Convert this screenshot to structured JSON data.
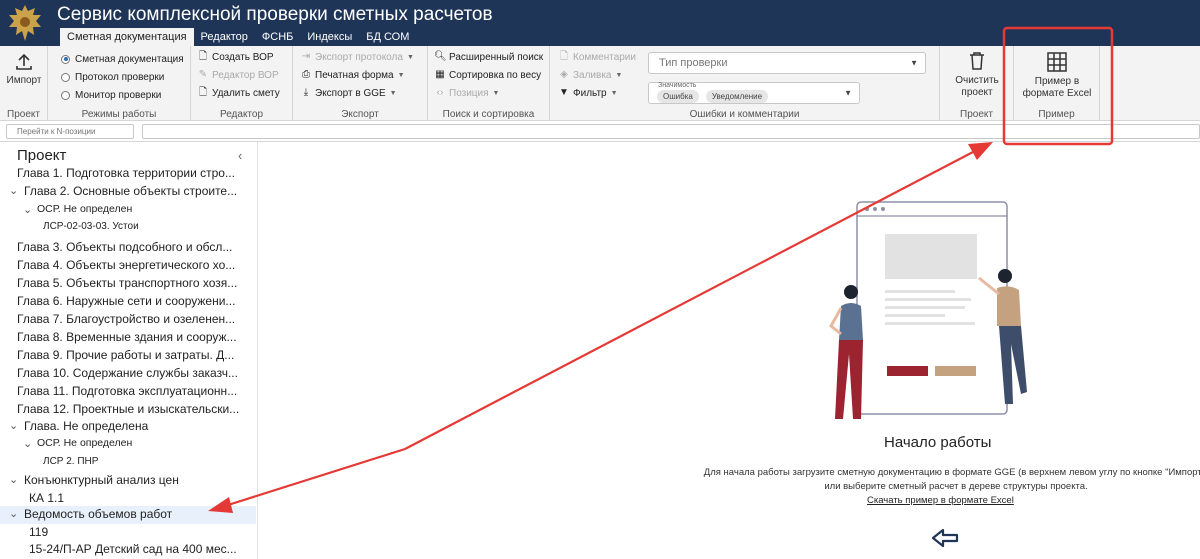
{
  "app": {
    "title": "Сервис комплексной проверки сметных расчетов",
    "menu_tabs": [
      "Сметная документация",
      "Редактор",
      "ФСНБ",
      "Индексы",
      "БД СОМ"
    ]
  },
  "ribbon": {
    "project_group": {
      "title": "Проект",
      "import_label": "Импорт"
    },
    "modes_group": {
      "title": "Режимы работы",
      "options": [
        "Сметная документация",
        "Протокол проверки",
        "Монитор проверки"
      ],
      "selected": 0
    },
    "editor_group": {
      "title": "Редактор",
      "items": [
        "Создать ВОР",
        "Редактор ВОР",
        "Удалить смету"
      ]
    },
    "export_group": {
      "title": "Экспорт",
      "items": [
        "Экспорт протокола",
        "Печатная форма",
        "Экспорт в GGE"
      ]
    },
    "search_group": {
      "title": "Поиск и сортировка",
      "items": [
        "Расширенный поиск",
        "Сортировка по весу",
        "Позиция"
      ]
    },
    "errors_group": {
      "title": "Ошибки и комментарии",
      "items": [
        "Комментарии",
        "Заливка",
        "Фильтр"
      ],
      "check_type_placeholder": "Тип проверки",
      "significance_label": "Значимость",
      "chips": [
        "Ошибка",
        "Уведомление"
      ]
    },
    "clear_group": {
      "title": "Проект",
      "clear_label_1": "Очистить",
      "clear_label_2": "проект"
    },
    "example_group": {
      "title": "Пример",
      "label_1": "Пример в",
      "label_2": "формате Excel"
    }
  },
  "search": {
    "npos_placeholder": "Перейти к N-позиции"
  },
  "tree": {
    "title": "Проект",
    "nodes": [
      {
        "label": "Глава 1. Подготовка территории стро..."
      },
      {
        "label": "Глава 2. Основные объекты строите..."
      },
      {
        "label": "ОСР. Не определен"
      },
      {
        "label": "ЛСР-02-03-03. Устои"
      },
      {
        "label": "Глава 3. Объекты подсобного и обсл..."
      },
      {
        "label": "Глава 4. Объекты энергетического хо..."
      },
      {
        "label": "Глава 5. Объекты транспортного хозя..."
      },
      {
        "label": "Глава 6. Наружные сети и сооружени..."
      },
      {
        "label": "Глава 7. Благоустройство и озеленен..."
      },
      {
        "label": "Глава 8. Временные здания и сооруж..."
      },
      {
        "label": "Глава 9. Прочие работы и затраты. Д..."
      },
      {
        "label": "Глава 10. Содержание службы заказч..."
      },
      {
        "label": "Глава 11. Подготовка эксплуатационн..."
      },
      {
        "label": "Глава 12. Проектные и изыскательски..."
      },
      {
        "label": "Глава. Не определена"
      },
      {
        "label": "ОСР. Не определен"
      },
      {
        "label": "ЛСР 2. ПНР"
      },
      {
        "label": "Конъюнктурный анализ цен"
      },
      {
        "label": "КА 1.1"
      },
      {
        "label": "Ведомость объемов работ"
      },
      {
        "label": "119"
      },
      {
        "label": "15-24/П-АР Детский сад на 400 мес..."
      }
    ]
  },
  "start": {
    "title": "Начало работы",
    "desc_line1": "Для начала работы загрузите сметную документацию в формате GGE (в верхнем левом углу по кнопке \"Импорт\")",
    "desc_line2": "или выберите сметный расчет в дереве структуры проекта.",
    "link": "Скачать пример в формате Excel"
  },
  "colors": {
    "titlebar": "#1f3557",
    "annotation": "#e53935",
    "accent_red": "#9c2430",
    "accent_tan": "#c4a27f"
  }
}
